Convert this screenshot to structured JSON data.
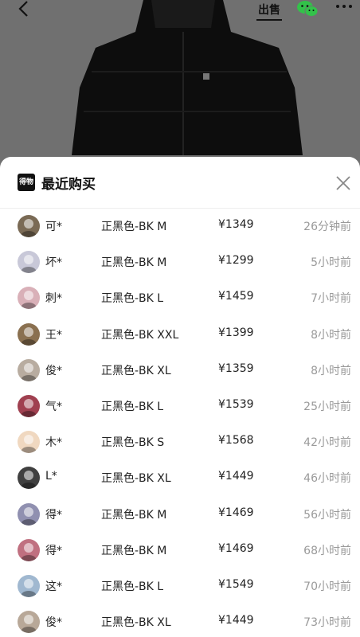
{
  "topbar": {
    "back_icon": "chevron-left-icon",
    "sell_label": "出售",
    "share_icon": "wechat-icon",
    "more_icon": "more-dots-icon"
  },
  "sheet": {
    "logo_text": "得物",
    "title": "最近购买",
    "close_icon": "close-icon"
  },
  "colors": {
    "overlay": "#707070",
    "time_text": "#9a9a9a",
    "wechat_green": "#33c24a"
  },
  "purchases": [
    {
      "name": "可*",
      "spec": "正黑色-BK M",
      "price": "¥1349",
      "time": "26分钟前",
      "avatar_color": "#7a6a55"
    },
    {
      "name": "坏*",
      "spec": "正黑色-BK M",
      "price": "¥1299",
      "time": "5小时前",
      "avatar_color": "#c8c8d8"
    },
    {
      "name": "刺*",
      "spec": "正黑色-BK L",
      "price": "¥1459",
      "time": "7小时前",
      "avatar_color": "#d9b0b8"
    },
    {
      "name": "王*",
      "spec": "正黑色-BK XXL",
      "price": "¥1399",
      "time": "8小时前",
      "avatar_color": "#8a7050"
    },
    {
      "name": "俊*",
      "spec": "正黑色-BK XL",
      "price": "¥1359",
      "time": "8小时前",
      "avatar_color": "#b8aca0"
    },
    {
      "name": "气*",
      "spec": "正黑色-BK L",
      "price": "¥1539",
      "time": "25小时前",
      "avatar_color": "#a04050"
    },
    {
      "name": "木*",
      "spec": "正黑色-BK S",
      "price": "¥1568",
      "time": "42小时前",
      "avatar_color": "#f0d8c0"
    },
    {
      "name": "L*",
      "spec": "正黑色-BK XL",
      "price": "¥1449",
      "time": "46小时前",
      "avatar_color": "#404040"
    },
    {
      "name": "得*",
      "spec": "正黑色-BK M",
      "price": "¥1469",
      "time": "56小时前",
      "avatar_color": "#9090b0"
    },
    {
      "name": "得*",
      "spec": "正黑色-BK M",
      "price": "¥1469",
      "time": "68小时前",
      "avatar_color": "#c07080"
    },
    {
      "name": "这*",
      "spec": "正黑色-BK L",
      "price": "¥1549",
      "time": "70小时前",
      "avatar_color": "#a0b8d0"
    },
    {
      "name": "俊*",
      "spec": "正黑色-BK XL",
      "price": "¥1449",
      "time": "73小时前",
      "avatar_color": "#b8a898"
    }
  ]
}
